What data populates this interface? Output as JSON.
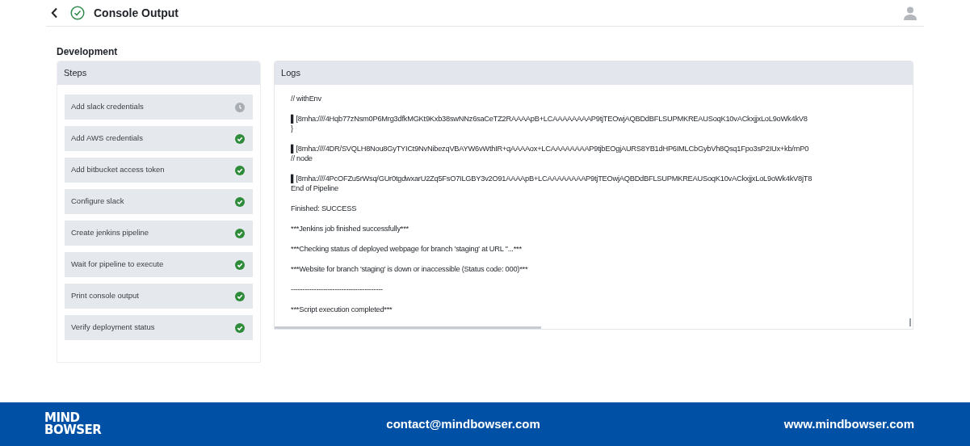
{
  "header": {
    "title": "Console Output"
  },
  "section": {
    "title": "Development"
  },
  "steps": {
    "title": "Steps",
    "items": [
      {
        "label": "Add slack credentials",
        "done": false
      },
      {
        "label": "Add AWS credentials",
        "done": true
      },
      {
        "label": "Add bitbucket access token",
        "done": true
      },
      {
        "label": "Configure slack",
        "done": true
      },
      {
        "label": "Create jenkins pipeline",
        "done": true
      },
      {
        "label": "Wait for pipeline to execute",
        "done": true
      },
      {
        "label": "Print console output",
        "done": true
      },
      {
        "label": "Verify deployment status",
        "done": true
      }
    ]
  },
  "logs": {
    "title": "Logs",
    "blocks": [
      [
        "// withEnv"
      ],
      [
        "▌[8mha:////4Hqb77zNsm0P6Mrg3dfkMGKt9Kxb38swNNz6saCeTZ2RAAAApB+LCAAAAAAAAP9tjTEOwjAQBDdBFLSUPMKREAUSoqK10vACkxjjxLoL9oWk4kV8",
        "}"
      ],
      [
        "▌[8mha:////4DR/SVQLH8Nou8GyTYICt9NvNibezqVBAYW6vWthIR+qAAAAox+LCAAAAAAAAP9tjbEOgjAURS8YB1dHP6IMLCbGybVh8Qsq1Fpo3sP2IUx+kb/mP0",
        "// node"
      ],
      [
        "▌[8mha:////4PcOFZu5rWsq/GUr0tgdwxarU2Zq5FsO7ILGBY3v2O91AAAApB+LCAAAAAAAAP9tjTEOwjAQBDdBFLSUPMKREAUSoqK10vACkxjjxLoL9oWk4kV8jT8",
        "End of Pipeline"
      ],
      [
        "Finished: SUCCESS"
      ],
      [
        "***Jenkins job finished successfully***"
      ],
      [
        "***Checking status of deployed webpage for branch 'staging' at URL ''...***"
      ],
      [
        "***Website for branch 'staging' is down or inaccessible (Status code: 000)***"
      ],
      [
        "----------------------------------------"
      ],
      [
        "***Script execution completed***"
      ]
    ]
  },
  "footer": {
    "logo_top": "MIND",
    "logo_bottom": "BOWSER",
    "email": "contact@mindbowser.com",
    "website": "www.mindbowser.com"
  }
}
